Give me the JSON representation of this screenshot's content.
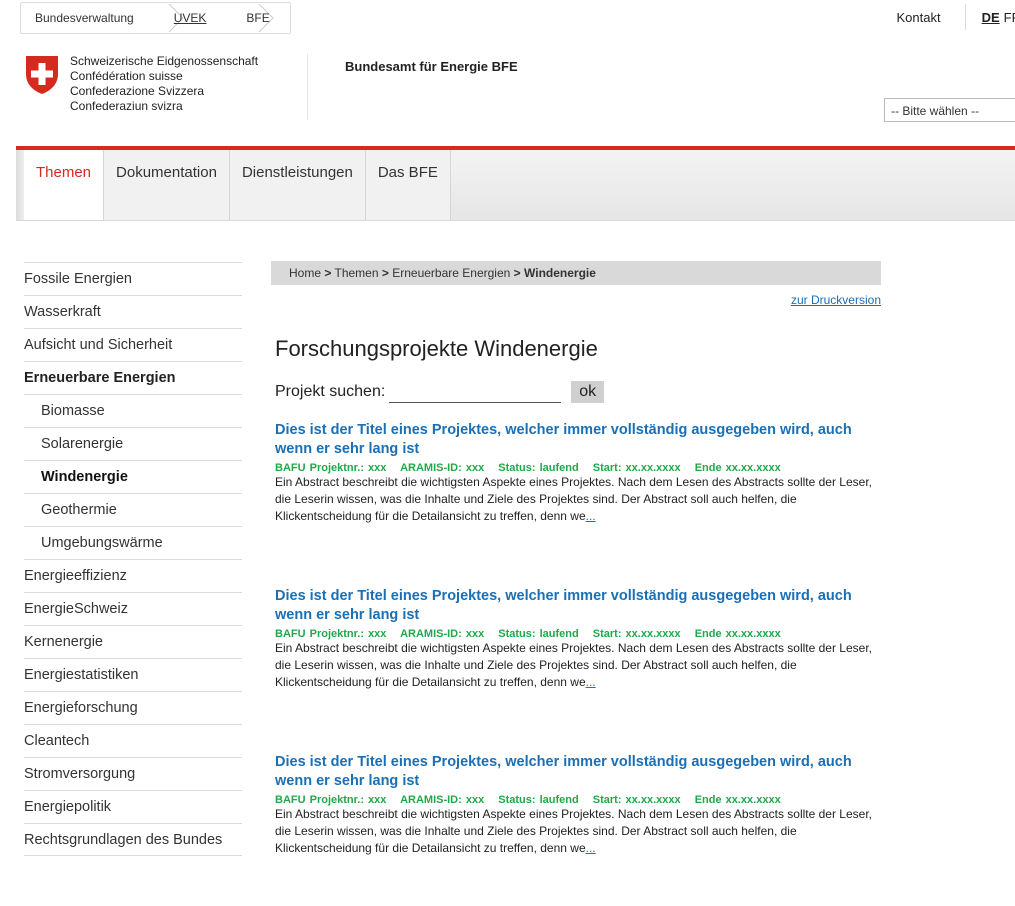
{
  "top": {
    "crumbs": [
      "Bundesverwaltung",
      "UVEK",
      "BFE"
    ],
    "kontakt": "Kontakt",
    "lang_active": "DE",
    "lang_next": "FR"
  },
  "header": {
    "confed": [
      "Schweizerische Eidgenossenschaft",
      "Confédération suisse",
      "Confederazione Svizzera",
      "Confederaziun svizra"
    ],
    "office": "Bundesamt für Energie BFE",
    "select_value": "-- Bitte wählen --"
  },
  "nav": [
    "Themen",
    "Dokumentation",
    "Dienstleistungen",
    "Das BFE"
  ],
  "sidebar": [
    "Fossile Energien",
    "Wasserkraft",
    "Aufsicht und Sicherheit",
    "Erneuerbare Energien",
    "Biomasse",
    "Solarenergie",
    "Windenergie",
    "Geothermie",
    "Umgebungswärme",
    "Energieeffizienz",
    "EnergieSchweiz",
    "Kernenergie",
    "Energiestatistiken",
    "Energieforschung",
    "Cleantech",
    "Stromversorgung",
    "Energiepolitik",
    "Rechtsgrundlagen des Bundes"
  ],
  "breadcrumb": {
    "home": "Home",
    "themen": "Themen",
    "erneuerbare": "Erneuerbare Energien",
    "current": "Windenergie",
    "sep": ">"
  },
  "print_label": "zur Druckversion",
  "page_title": "Forschungsprojekte Windenergie",
  "search": {
    "label": "Projekt suchen:",
    "ok": "ok"
  },
  "projects": [
    {
      "title": "Dies ist der Titel eines Projektes, welcher immer vollständig ausgegeben wird, auch wenn er sehr lang ist",
      "meta": [
        "BAFU Projektnr.: xxx",
        "ARAMIS-ID: xxx",
        "Status: laufend",
        "Start: xx.xx.xxxx",
        "Ende xx.xx.xxxx"
      ],
      "abstract": "Ein Abstract beschreibt die wichtigsten Aspekte eines Projektes. Nach dem Lesen des Abstracts sollte der Leser, die Leserin wissen, was die Inhalte und Ziele des Projektes sind. Der Abstract soll auch helfen, die Klickentscheidung für die Detailansicht zu treffen, denn we",
      "more": "..."
    },
    {
      "title": "Dies ist der Titel eines Projektes, welcher immer vollständig ausgegeben wird, auch wenn er sehr lang ist",
      "meta": [
        "BAFU Projektnr.: xxx",
        "ARAMIS-ID: xxx",
        "Status: laufend",
        "Start: xx.xx.xxxx",
        "Ende xx.xx.xxxx"
      ],
      "abstract": "Ein Abstract beschreibt die wichtigsten Aspekte eines Projektes. Nach dem Lesen des Abstracts sollte der Leser, die Leserin wissen, was die Inhalte und Ziele des Projektes sind. Der Abstract soll auch helfen, die Klickentscheidung für die Detailansicht zu treffen, denn we",
      "more": "..."
    },
    {
      "title": "Dies ist der Titel eines Projektes, welcher immer vollständig ausgegeben wird, auch wenn er sehr lang ist",
      "meta": [
        "BAFU Projektnr.: xxx",
        "ARAMIS-ID: xxx",
        "Status: laufend",
        "Start: xx.xx.xxxx",
        "Ende xx.xx.xxxx"
      ],
      "abstract": "Ein Abstract beschreibt die wichtigsten Aspekte eines Projektes. Nach dem Lesen des Abstracts sollte der Leser, die Leserin wissen, was die Inhalte und Ziele des Projektes sind. Der Abstract soll auch helfen, die Klickentscheidung für die Detailansicht zu treffen, denn we",
      "more": "..."
    }
  ],
  "colors": {
    "brand_red": "#d52b1e",
    "link_blue": "#1a6fb5",
    "meta_green": "#21a84a"
  }
}
